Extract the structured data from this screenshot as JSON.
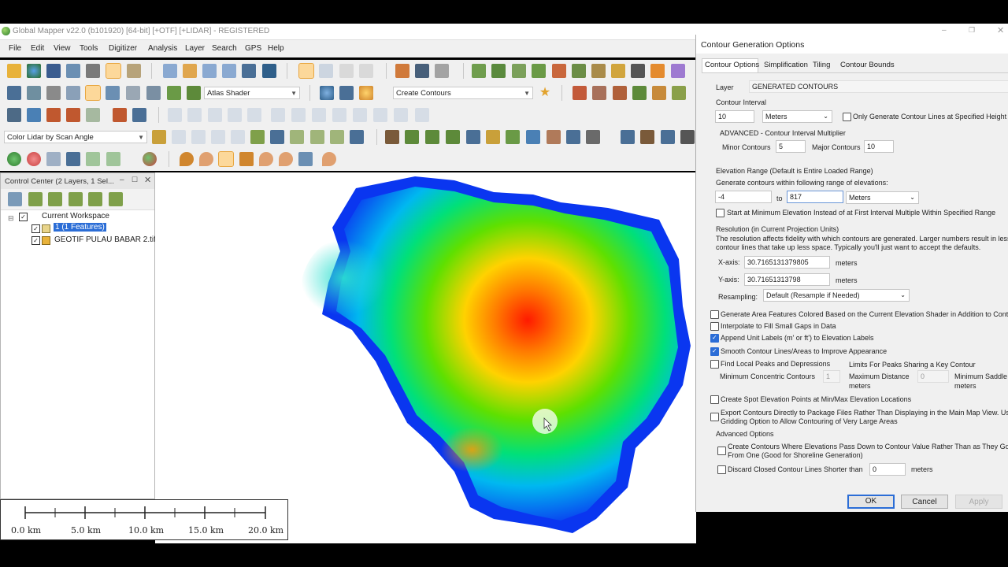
{
  "window": {
    "title": "Global Mapper v22.0 (b101920) [64-bit] [+OTF] [+LIDAR] - REGISTERED"
  },
  "menu": [
    "File",
    "Edit",
    "View",
    "Tools",
    "Digitizer",
    "Analysis",
    "Layer",
    "Search",
    "GPS",
    "Help"
  ],
  "toolbar": {
    "shader_combo": "Atlas Shader",
    "contour_combo": "Create Contours",
    "lidar_combo": "Color Lidar by Scan Angle"
  },
  "control_center": {
    "title": "Control Center (2 Layers, 1 Sel...",
    "workspace": "Current Workspace",
    "layers": [
      "1 (1 Features)",
      "GEOTIF PULAU BABAR 2.tif"
    ]
  },
  "scale_bar": {
    "labels": [
      "0.0 km",
      "5.0 km",
      "10.0 km",
      "15.0 km",
      "20.0 km"
    ]
  },
  "dialog": {
    "title": "Contour Generation Options",
    "tabs": [
      "Contour Options",
      "Simplification",
      "Tiling",
      "Contour Bounds"
    ],
    "layer_label": "Layer",
    "layer_value": "GENERATED CONTOURS",
    "interval_label": "Contour Interval",
    "interval_value": "10",
    "interval_units": "Meters",
    "only_specified": "Only Generate Contour Lines at Specified Height",
    "advanced_mult": "ADVANCED - Contour Interval Multiplier",
    "minor_label": "Minor Contours",
    "minor_value": "5",
    "major_label": "Major Contours",
    "major_value": "10",
    "elev_range_label": "Elevation Range (Default is Entire Loaded Range)",
    "elev_gen_label": "Generate contours within following range of elevations:",
    "elev_min": "-4",
    "elev_to": "to",
    "elev_max": "817",
    "elev_units": "Meters",
    "start_at_min": "Start at Minimum Elevation Instead of at First Interval Multiple Within Specified Range",
    "resolution_label": "Resolution (in Current Projection Units)",
    "resolution_desc1": "The resolution affects fidelity with which contours are generated.  Larger numbers result in less",
    "resolution_desc2": "contour lines that take up less space.  Typically you'll just want to accept the defaults.",
    "xaxis_label": "X-axis:",
    "xaxis_value": "30.7165131379805",
    "yaxis_label": "Y-axis:",
    "yaxis_value": "30.71651313798",
    "meters": "meters",
    "resampling_label": "Resampling:",
    "resampling_value": "Default (Resample if Needed)",
    "opt_area_features": "Generate Area Features Colored Based on the Current Elevation Shader in Addition to Conto",
    "opt_interpolate": "Interpolate to Fill Small Gaps in Data",
    "opt_append_units": "Append Unit Labels (m' or ft') to Elevation Labels",
    "opt_smooth": "Smooth Contour Lines/Areas to Improve Appearance",
    "opt_find_peaks": "Find Local Peaks and Depressions",
    "limits_label": "Limits For Peaks Sharing a Key Contour",
    "min_concentric_label": "Minimum  Concentric Contours",
    "min_concentric_value": "1",
    "max_distance_label": "Maximum Distance",
    "max_distance_units": "meters",
    "max_distance_value": "0",
    "min_saddle_label": "Minimum Saddle",
    "min_saddle_units": "meters",
    "opt_spot_elev": "Create Spot Elevation Points at Min/Max Elevation Locations",
    "opt_export1": "Export Contours Directly to Package Files Rather Than Displaying in the Main Map View. Us",
    "opt_export2": "Gridding Option to Allow Contouring of Very Large Areas",
    "advanced_options": "Advanced Options",
    "opt_pass_down1": "Create Contours Where Elevations Pass Down to Contour Value Rather Than as They Go",
    "opt_pass_down2": "From One (Good for Shoreline Generation)",
    "opt_discard": "Discard Closed Contour Lines Shorter than",
    "discard_value": "0",
    "discard_units": "meters",
    "ok": "OK",
    "cancel": "Cancel",
    "apply": "Apply"
  },
  "colors": {
    "selection": "#2b6dd6",
    "highlight": "#fcd89a",
    "dialog_bg": "#f0f0f0"
  }
}
